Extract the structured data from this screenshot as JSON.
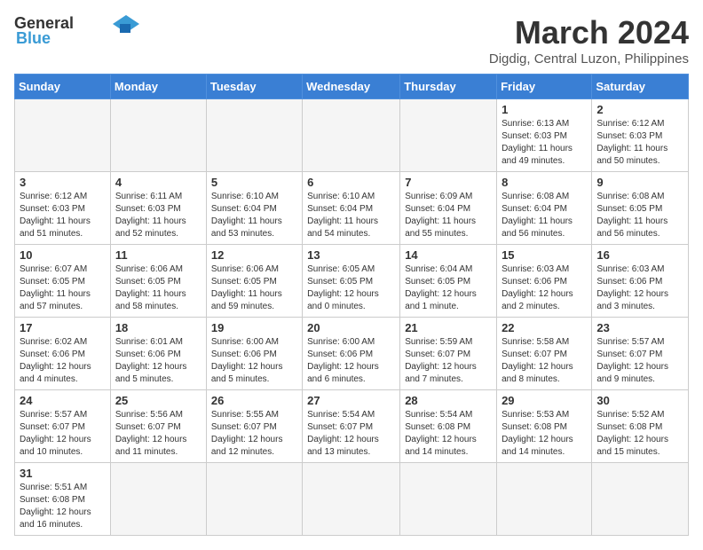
{
  "header": {
    "logo_general": "General",
    "logo_blue": "Blue",
    "month_title": "March 2024",
    "location": "Digdig, Central Luzon, Philippines"
  },
  "weekdays": [
    "Sunday",
    "Monday",
    "Tuesday",
    "Wednesday",
    "Thursday",
    "Friday",
    "Saturday"
  ],
  "weeks": [
    [
      {
        "day": "",
        "sunrise": "",
        "sunset": "",
        "daylight": "",
        "empty": true
      },
      {
        "day": "",
        "sunrise": "",
        "sunset": "",
        "daylight": "",
        "empty": true
      },
      {
        "day": "",
        "sunrise": "",
        "sunset": "",
        "daylight": "",
        "empty": true
      },
      {
        "day": "",
        "sunrise": "",
        "sunset": "",
        "daylight": "",
        "empty": true
      },
      {
        "day": "",
        "sunrise": "",
        "sunset": "",
        "daylight": "",
        "empty": true
      },
      {
        "day": "1",
        "sunrise": "Sunrise: 6:13 AM",
        "sunset": "Sunset: 6:03 PM",
        "daylight": "Daylight: 11 hours and 49 minutes."
      },
      {
        "day": "2",
        "sunrise": "Sunrise: 6:12 AM",
        "sunset": "Sunset: 6:03 PM",
        "daylight": "Daylight: 11 hours and 50 minutes."
      }
    ],
    [
      {
        "day": "3",
        "sunrise": "Sunrise: 6:12 AM",
        "sunset": "Sunset: 6:03 PM",
        "daylight": "Daylight: 11 hours and 51 minutes."
      },
      {
        "day": "4",
        "sunrise": "Sunrise: 6:11 AM",
        "sunset": "Sunset: 6:03 PM",
        "daylight": "Daylight: 11 hours and 52 minutes."
      },
      {
        "day": "5",
        "sunrise": "Sunrise: 6:10 AM",
        "sunset": "Sunset: 6:04 PM",
        "daylight": "Daylight: 11 hours and 53 minutes."
      },
      {
        "day": "6",
        "sunrise": "Sunrise: 6:10 AM",
        "sunset": "Sunset: 6:04 PM",
        "daylight": "Daylight: 11 hours and 54 minutes."
      },
      {
        "day": "7",
        "sunrise": "Sunrise: 6:09 AM",
        "sunset": "Sunset: 6:04 PM",
        "daylight": "Daylight: 11 hours and 55 minutes."
      },
      {
        "day": "8",
        "sunrise": "Sunrise: 6:08 AM",
        "sunset": "Sunset: 6:04 PM",
        "daylight": "Daylight: 11 hours and 56 minutes."
      },
      {
        "day": "9",
        "sunrise": "Sunrise: 6:08 AM",
        "sunset": "Sunset: 6:05 PM",
        "daylight": "Daylight: 11 hours and 56 minutes."
      }
    ],
    [
      {
        "day": "10",
        "sunrise": "Sunrise: 6:07 AM",
        "sunset": "Sunset: 6:05 PM",
        "daylight": "Daylight: 11 hours and 57 minutes."
      },
      {
        "day": "11",
        "sunrise": "Sunrise: 6:06 AM",
        "sunset": "Sunset: 6:05 PM",
        "daylight": "Daylight: 11 hours and 58 minutes."
      },
      {
        "day": "12",
        "sunrise": "Sunrise: 6:06 AM",
        "sunset": "Sunset: 6:05 PM",
        "daylight": "Daylight: 11 hours and 59 minutes."
      },
      {
        "day": "13",
        "sunrise": "Sunrise: 6:05 AM",
        "sunset": "Sunset: 6:05 PM",
        "daylight": "Daylight: 12 hours and 0 minutes."
      },
      {
        "day": "14",
        "sunrise": "Sunrise: 6:04 AM",
        "sunset": "Sunset: 6:05 PM",
        "daylight": "Daylight: 12 hours and 1 minute."
      },
      {
        "day": "15",
        "sunrise": "Sunrise: 6:03 AM",
        "sunset": "Sunset: 6:06 PM",
        "daylight": "Daylight: 12 hours and 2 minutes."
      },
      {
        "day": "16",
        "sunrise": "Sunrise: 6:03 AM",
        "sunset": "Sunset: 6:06 PM",
        "daylight": "Daylight: 12 hours and 3 minutes."
      }
    ],
    [
      {
        "day": "17",
        "sunrise": "Sunrise: 6:02 AM",
        "sunset": "Sunset: 6:06 PM",
        "daylight": "Daylight: 12 hours and 4 minutes."
      },
      {
        "day": "18",
        "sunrise": "Sunrise: 6:01 AM",
        "sunset": "Sunset: 6:06 PM",
        "daylight": "Daylight: 12 hours and 5 minutes."
      },
      {
        "day": "19",
        "sunrise": "Sunrise: 6:00 AM",
        "sunset": "Sunset: 6:06 PM",
        "daylight": "Daylight: 12 hours and 5 minutes."
      },
      {
        "day": "20",
        "sunrise": "Sunrise: 6:00 AM",
        "sunset": "Sunset: 6:06 PM",
        "daylight": "Daylight: 12 hours and 6 minutes."
      },
      {
        "day": "21",
        "sunrise": "Sunrise: 5:59 AM",
        "sunset": "Sunset: 6:07 PM",
        "daylight": "Daylight: 12 hours and 7 minutes."
      },
      {
        "day": "22",
        "sunrise": "Sunrise: 5:58 AM",
        "sunset": "Sunset: 6:07 PM",
        "daylight": "Daylight: 12 hours and 8 minutes."
      },
      {
        "day": "23",
        "sunrise": "Sunrise: 5:57 AM",
        "sunset": "Sunset: 6:07 PM",
        "daylight": "Daylight: 12 hours and 9 minutes."
      }
    ],
    [
      {
        "day": "24",
        "sunrise": "Sunrise: 5:57 AM",
        "sunset": "Sunset: 6:07 PM",
        "daylight": "Daylight: 12 hours and 10 minutes."
      },
      {
        "day": "25",
        "sunrise": "Sunrise: 5:56 AM",
        "sunset": "Sunset: 6:07 PM",
        "daylight": "Daylight: 12 hours and 11 minutes."
      },
      {
        "day": "26",
        "sunrise": "Sunrise: 5:55 AM",
        "sunset": "Sunset: 6:07 PM",
        "daylight": "Daylight: 12 hours and 12 minutes."
      },
      {
        "day": "27",
        "sunrise": "Sunrise: 5:54 AM",
        "sunset": "Sunset: 6:07 PM",
        "daylight": "Daylight: 12 hours and 13 minutes."
      },
      {
        "day": "28",
        "sunrise": "Sunrise: 5:54 AM",
        "sunset": "Sunset: 6:08 PM",
        "daylight": "Daylight: 12 hours and 14 minutes."
      },
      {
        "day": "29",
        "sunrise": "Sunrise: 5:53 AM",
        "sunset": "Sunset: 6:08 PM",
        "daylight": "Daylight: 12 hours and 14 minutes."
      },
      {
        "day": "30",
        "sunrise": "Sunrise: 5:52 AM",
        "sunset": "Sunset: 6:08 PM",
        "daylight": "Daylight: 12 hours and 15 minutes."
      }
    ],
    [
      {
        "day": "31",
        "sunrise": "Sunrise: 5:51 AM",
        "sunset": "Sunset: 6:08 PM",
        "daylight": "Daylight: 12 hours and 16 minutes."
      },
      {
        "day": "",
        "empty": true
      },
      {
        "day": "",
        "empty": true
      },
      {
        "day": "",
        "empty": true
      },
      {
        "day": "",
        "empty": true
      },
      {
        "day": "",
        "empty": true
      },
      {
        "day": "",
        "empty": true
      }
    ]
  ]
}
